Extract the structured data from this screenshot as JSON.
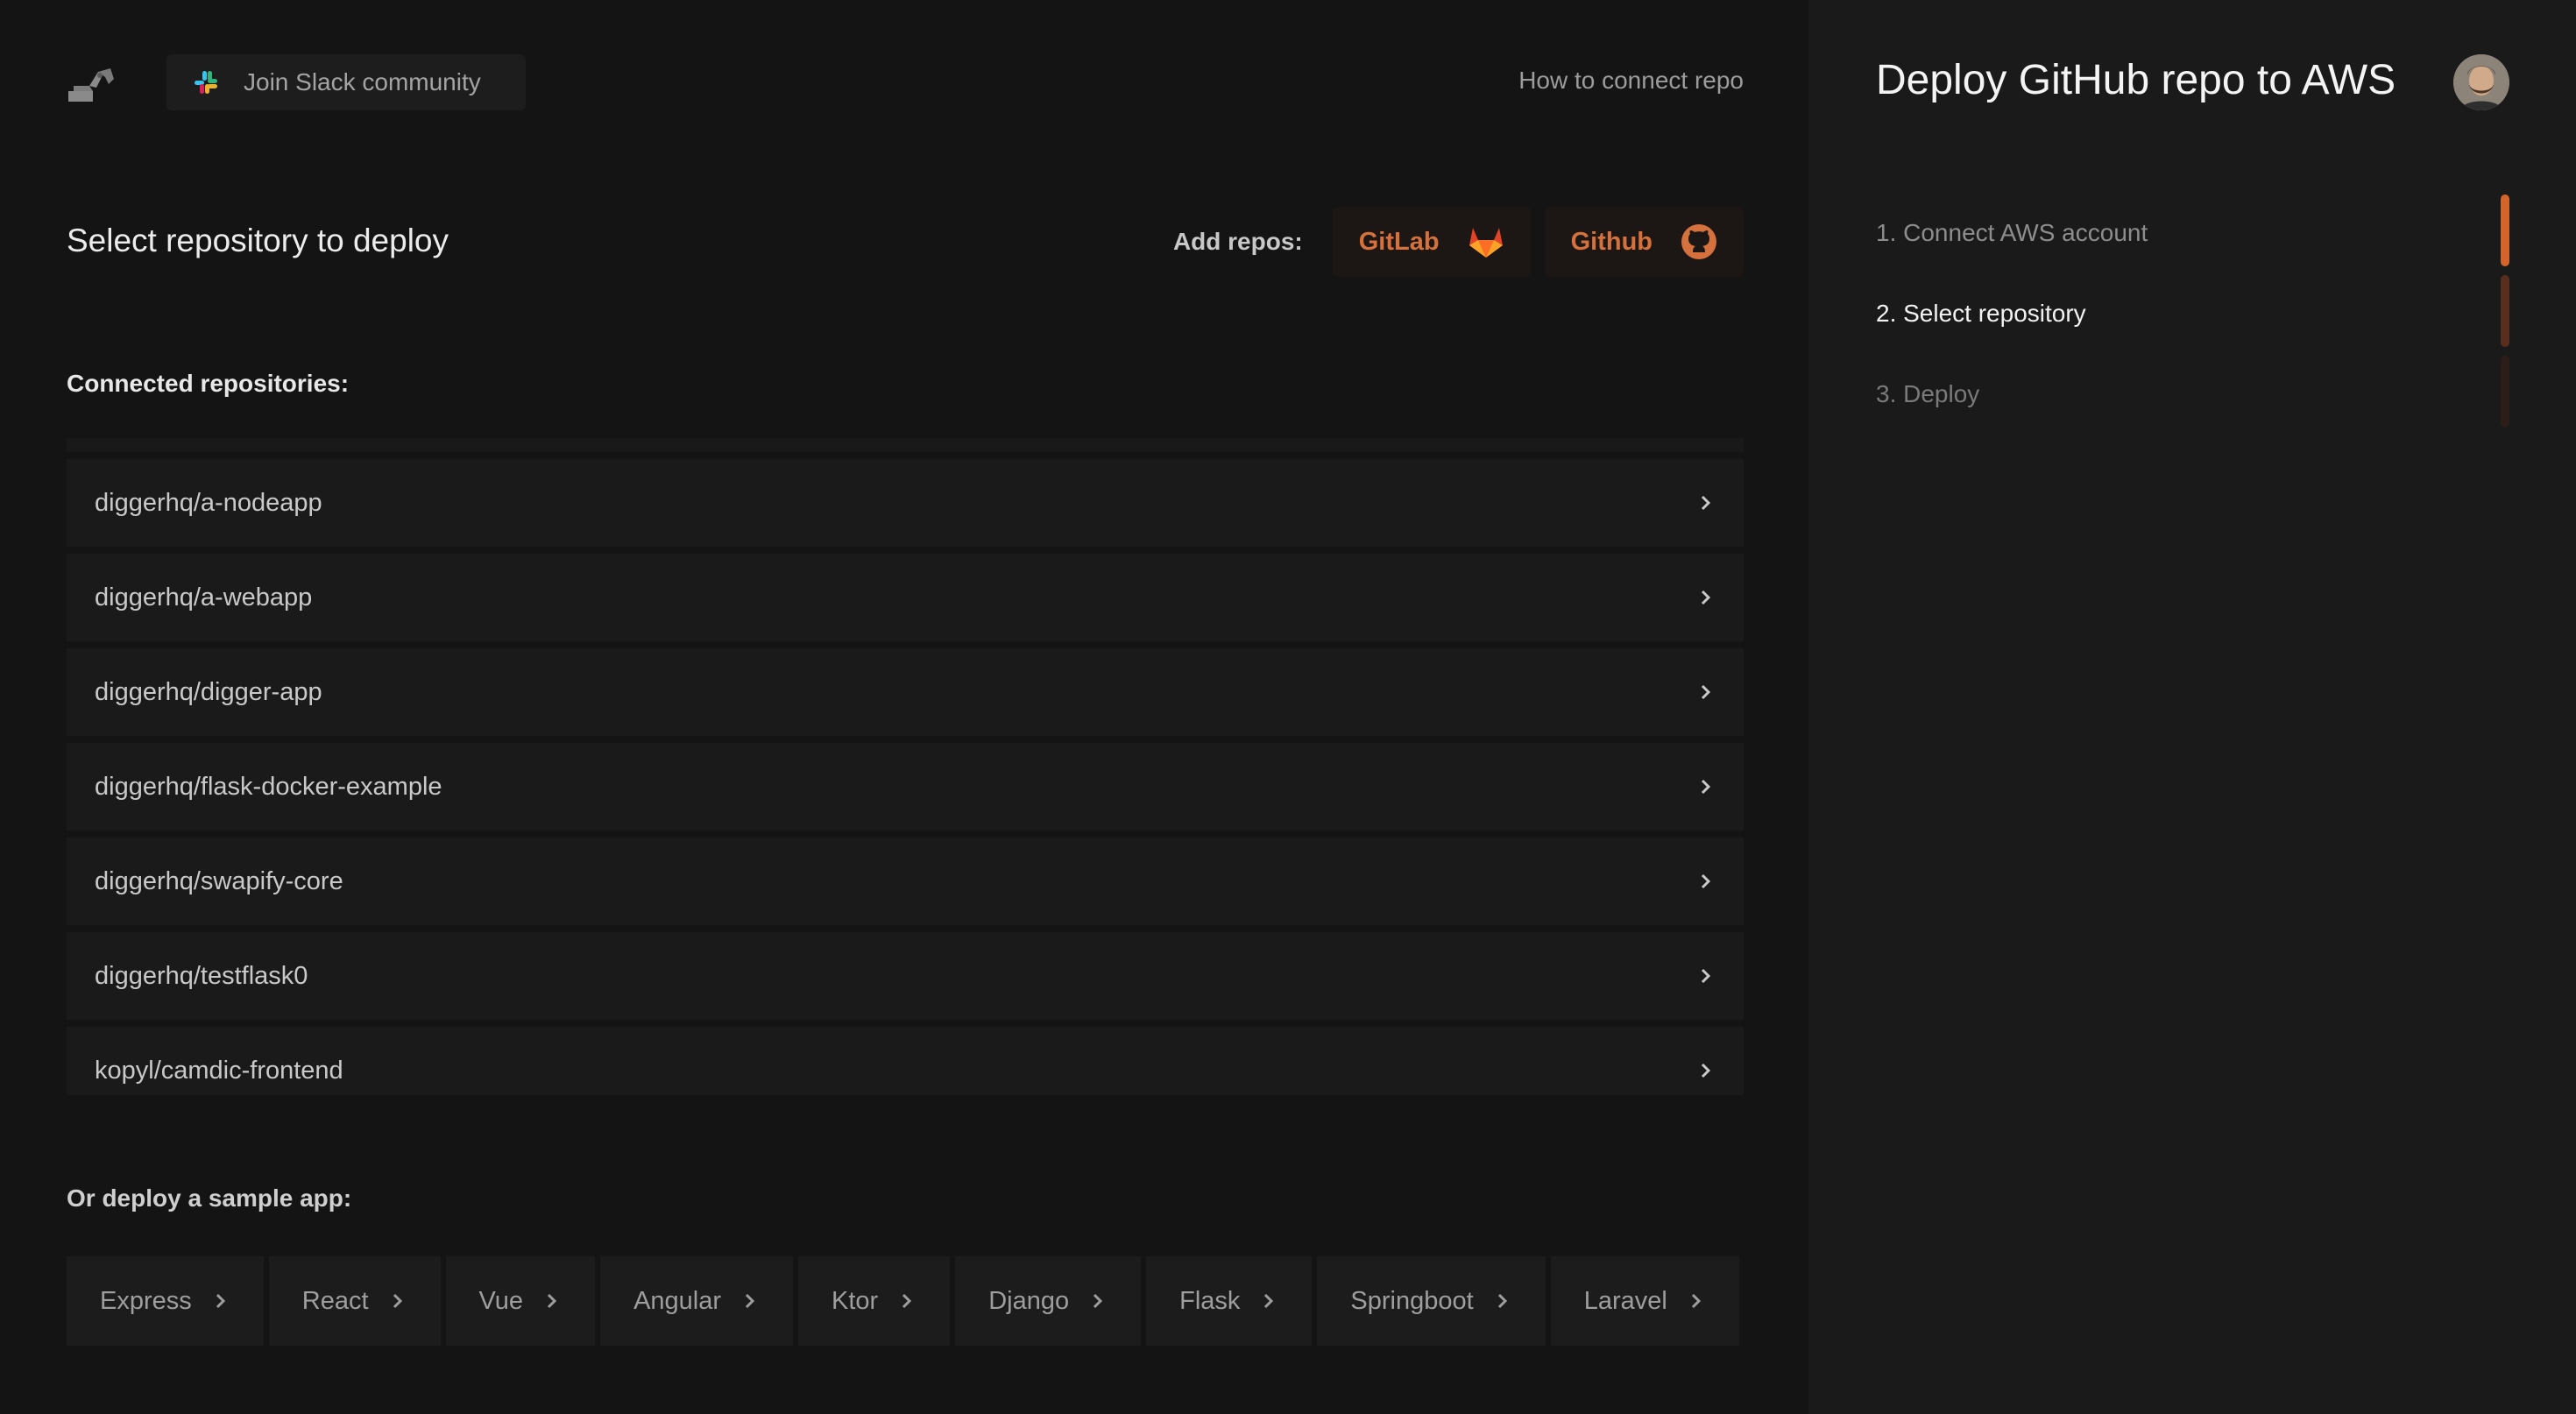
{
  "header": {
    "slack_label": "Join Slack community",
    "how_to_label": "How to connect repo"
  },
  "select_section": {
    "title": "Select repository to deploy",
    "add_repos_label": "Add repos:",
    "providers": [
      {
        "label": "GitLab",
        "icon": "gitlab-icon"
      },
      {
        "label": "Github",
        "icon": "github-icon"
      }
    ]
  },
  "connected": {
    "label": "Connected repositories:",
    "repos": [
      "diggerhq/a-nodeapp",
      "diggerhq/a-webapp",
      "diggerhq/digger-app",
      "diggerhq/flask-docker-example",
      "diggerhq/swapify-core",
      "diggerhq/testflask0",
      "kopyl/camdic-frontend"
    ]
  },
  "samples": {
    "label": "Or deploy a sample app:",
    "apps": [
      "Express",
      "React",
      "Vue",
      "Angular",
      "Ktor",
      "Django",
      "Flask",
      "Springboot",
      "Laravel"
    ]
  },
  "side_panel": {
    "title": "Deploy GitHub repo to AWS",
    "steps": [
      {
        "label": "1. Connect AWS account",
        "state": "done"
      },
      {
        "label": "2. Select repository",
        "state": "active"
      },
      {
        "label": "3. Deploy",
        "state": "todo"
      }
    ],
    "progress_colors": [
      "#d4642a",
      "#5a2e1e",
      "#2c1d19"
    ]
  },
  "colors": {
    "accent": "#d4713d",
    "background": "#141414",
    "panel": "#1a1a1a"
  }
}
